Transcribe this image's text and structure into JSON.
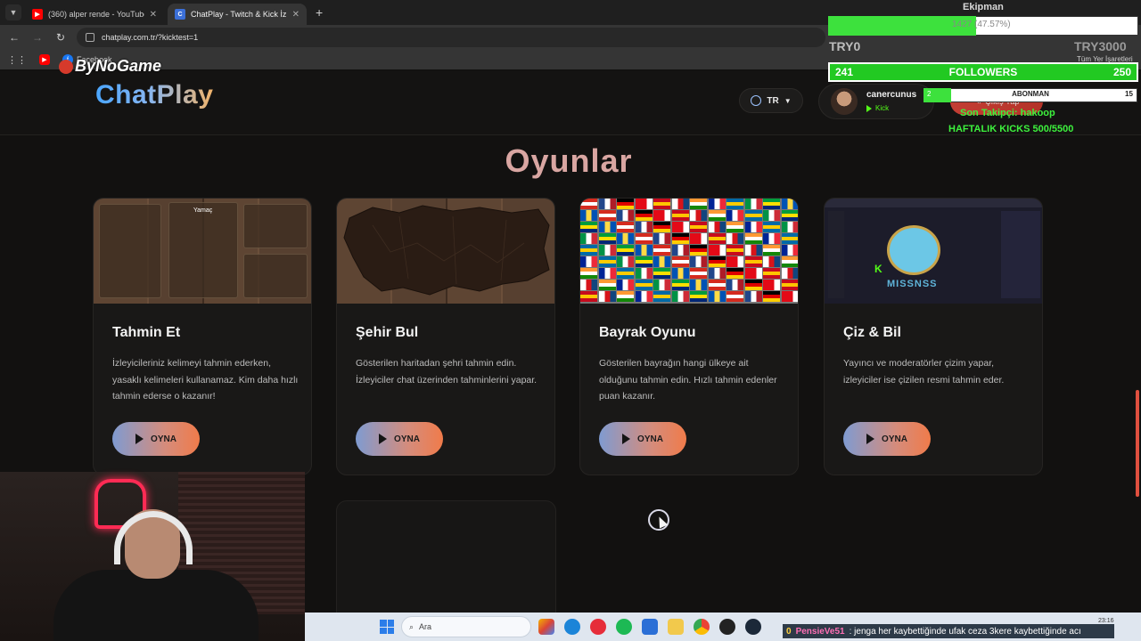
{
  "browser": {
    "tabs": [
      {
        "title": "(360) alper rende - YouTube",
        "favicon": "youtube-icon",
        "active": false
      },
      {
        "title": "ChatPlay - Twitch & Kick İzleyici",
        "favicon": "chatplay-icon",
        "active": true
      }
    ],
    "new_tab": "+",
    "url": "chatplay.com.tr/?kicktest=1",
    "bookmarks": [
      {
        "label": "Facebook",
        "icon": "facebook-icon"
      }
    ],
    "bookmarks_folder": "Tüm Yer İşaretleri"
  },
  "header": {
    "logo": "ChatPlay",
    "language": "TR",
    "user": {
      "name": "canercunus",
      "platform": "Kick"
    },
    "logout": "Çıkış Yap"
  },
  "main": {
    "section_title": "Oyunlar",
    "games": [
      {
        "title": "Tahmin Et",
        "description": "İzleyicileriniz kelimeyi tahmin ederken, yasaklı kelimeleri kullanamaz. Kim daha hızlı tahmin ederse o kazanır!",
        "button": "OYNA"
      },
      {
        "title": "Şehir Bul",
        "description": "Gösterilen haritadan şehri tahmin edin. İzleyiciler chat üzerinden tahminlerini yapar.",
        "button": "OYNA"
      },
      {
        "title": "Bayrak Oyunu",
        "description": "Gösterilen bayrağın hangi ülkeye ait olduğunu tahmin edin. Hızlı tahmin edenler puan kazanır.",
        "button": "OYNA"
      },
      {
        "title": "Çiz & Bil",
        "description": "Yayıncı ve moderatörler çizim yapar, izleyiciler ise çizilen resmi tahmin eder.",
        "button": "OYNA"
      }
    ],
    "thumb_labels": {
      "tahmin": "Yamaç",
      "draw": "MISSNSS"
    }
  },
  "overlay": {
    "watermark": "ByNoGame",
    "top_name": "Ekipman",
    "goal_bar_text": "1427 (47.57%)",
    "goal_progress": 0.4757,
    "goal_min": "TRY0",
    "goal_max": "TRY3000",
    "followers": {
      "left": "241",
      "label": "FOLLOWERS",
      "right": "250"
    },
    "subs": {
      "label": "ABONMAN",
      "min": "2",
      "count": "15",
      "progress": 0.13
    },
    "last_follower": "Son Takipçi: hakoop",
    "weekly_kicks": "HAFTALIK KICKS 500/5500"
  },
  "taskbar": {
    "search_placeholder": "Ara",
    "chat": {
      "num": "0",
      "nick": "PensieVe51",
      "msg": ": jenga her kaybettiğinde ufak ceza 3kere kaybettiğinde acı"
    },
    "time": "23:16"
  }
}
